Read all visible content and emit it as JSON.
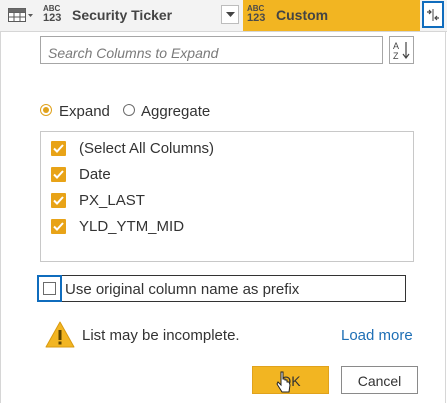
{
  "header": {
    "type_tag_top": "ABC",
    "type_tag_bottom": "123",
    "column_1": "Security Ticker",
    "column_2": "Custom",
    "icons": {
      "table": "table-icon",
      "dropdown": "chevron-down-icon",
      "expand": "expand-arrows-icon"
    }
  },
  "search": {
    "placeholder": "Search Columns to Expand",
    "value": "",
    "sort_icon": "sort-az-icon"
  },
  "mode": {
    "expand_label": "Expand",
    "aggregate_label": "Aggregate",
    "selected": "Expand"
  },
  "columns": [
    {
      "label": "(Select All Columns)",
      "checked": true
    },
    {
      "label": "Date",
      "checked": true
    },
    {
      "label": "PX_LAST",
      "checked": true
    },
    {
      "label": "YLD_YTM_MID",
      "checked": true
    }
  ],
  "prefix": {
    "label": "Use original column name as prefix",
    "checked": false
  },
  "warning": {
    "text": "List may be incomplete.",
    "link": "Load more",
    "icon": "warning-icon"
  },
  "buttons": {
    "ok": "OK",
    "cancel": "Cancel"
  },
  "colors": {
    "accent": "#f2b522",
    "selection_border": "#0f6cbd",
    "link": "#1e6fb5"
  }
}
